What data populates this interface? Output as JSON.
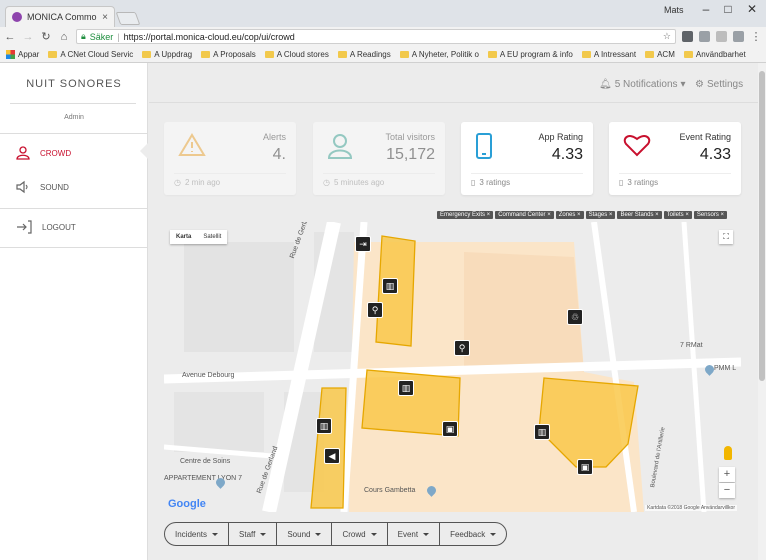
{
  "browser": {
    "tab_title": "MONICA Common Opera",
    "user_name": "Mats",
    "secure_label": "Säker",
    "url": "https://portal.monica-cloud.eu/cop/ui/crowd",
    "bookmarks": [
      "Appar",
      "A CNet Cloud Servic",
      "A Uppdrag",
      "A Proposals",
      "A Cloud stores",
      "A Readings",
      "A Nyheter, Politik o",
      "A EU program & info",
      "A Intressant",
      "ACM",
      "Användbarhet"
    ]
  },
  "sidebar": {
    "brand": "NUIT SONORES",
    "role": "Admin",
    "items": [
      {
        "label": "CROWD"
      },
      {
        "label": "SOUND"
      },
      {
        "label": "LOGOUT"
      }
    ]
  },
  "header": {
    "notifications": "5 Notifications",
    "settings": "Settings"
  },
  "cards": [
    {
      "title": "Alerts",
      "value": "4.",
      "footer": "2 min ago",
      "icon": "warning-icon"
    },
    {
      "title": "Total visitors",
      "value": "15,172",
      "footer": "5 minutes ago",
      "icon": "person-icon"
    },
    {
      "title": "App Rating",
      "value": "4.33",
      "footer": "3 ratings",
      "icon": "phone-icon"
    },
    {
      "title": "Event Rating",
      "value": "4.33",
      "footer": "3 ratings",
      "icon": "heart-icon"
    }
  ],
  "filters": [
    "Emergency Exits ×",
    "Command Center ×",
    "Zones ×",
    "Stages ×",
    "Beer Stands ×",
    "Toilets ×",
    "Sensors ×"
  ],
  "map": {
    "type_map": "Karta",
    "type_satellite": "Satellit",
    "labels": [
      "Rue de Gerland",
      "Avenue Debourg",
      "Rue de Gerland",
      "Centre de Soins",
      "APPARTEMENT LYON 7",
      "Cours Gambetta",
      "Boulevard de l'Artillerie",
      "7 RMat",
      "PMM L"
    ],
    "logo": "Google",
    "attribution": "Kartdata ©2018 Google   Användarvillkor"
  },
  "menu": [
    "Incidents",
    "Staff",
    "Sound",
    "Crowd",
    "Event",
    "Feedback"
  ],
  "colors": {
    "accent": "#c8102e",
    "zone_fill": "#f9c84a",
    "zone_border": "#e6a700"
  }
}
